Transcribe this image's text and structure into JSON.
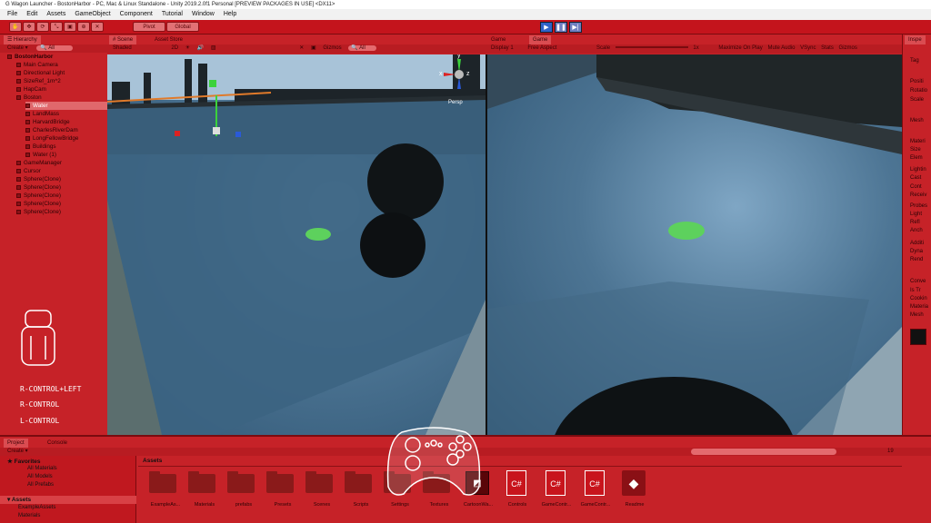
{
  "window": {
    "title": "G Wagon Launcher - BostonHarbor - PC, Mac & Linux Standalone - Unity 2019.2.0f1 Personal [PREVIEW PACKAGES IN USE] <DX11>"
  },
  "menu": [
    "File",
    "Edit",
    "Assets",
    "GameObject",
    "Component",
    "Tutorial",
    "Window",
    "Help"
  ],
  "toolbar": {
    "pivot": "Pivot",
    "global": "Global"
  },
  "hierarchy": {
    "tab": "Hierarchy",
    "create": "Create",
    "search": "All",
    "items": [
      "BostonHarbor",
      "Main Camera",
      "Directional Light",
      "SizeRef_1m^2",
      "HapCam",
      "Boston",
      "Water",
      "LandMass",
      "HarvardBridge",
      "CharlesRiverDam",
      "LongFellowBridge",
      "Buildings",
      "Water (1)",
      "GameManager",
      "Cursor",
      "Sphere(Clone)",
      "Sphere(Clone)",
      "Sphere(Clone)",
      "Sphere(Clone)",
      "Sphere(Clone)"
    ]
  },
  "scene": {
    "tab": "Scene",
    "tab2": "Asset Store",
    "shading": "Shaded",
    "mode2d": "2D",
    "gizmos": "Gizmos",
    "search": "All",
    "persp": "Persp",
    "axis_x": "x",
    "axis_y": "y",
    "axis_z": "z"
  },
  "game": {
    "tab": "Game",
    "tab_active": "Game",
    "display": "Display 1",
    "aspect": "Free Aspect",
    "scale_label": "Scale",
    "scale_value": "1x",
    "maximize": "Maximize On Play",
    "mute": "Mute Audio",
    "vsync": "VSync",
    "stats": "Stats",
    "gizmos": "Gizmos"
  },
  "inspector": {
    "tab": "Inspe",
    "items": [
      "Tag",
      "Positi",
      "Rotatio",
      "Scale",
      "Mesh",
      "Materi",
      "Size",
      "Elem",
      "Lightin",
      "Cast",
      "Cont",
      "Receiv",
      "Probes",
      "Light",
      "Refl",
      "Anch",
      "Additi",
      "Dyna",
      "Rend",
      "Conve",
      "Is Tr",
      "Cookin",
      "Materia",
      "Mesh"
    ]
  },
  "project": {
    "tab": "Project",
    "tab2": "Console",
    "create": "Create",
    "favorites": "Favorites",
    "fav_items": [
      "All Materials",
      "All Models",
      "All Prefabs"
    ],
    "assets_root": "Assets",
    "asset_tree": [
      "ExampleAssets",
      "Materials"
    ],
    "breadcrumb": "Assets",
    "count": "19",
    "assets": [
      {
        "label": "ExampleAs...",
        "kind": "folder"
      },
      {
        "label": "Materials",
        "kind": "folder"
      },
      {
        "label": "prefabs",
        "kind": "folder"
      },
      {
        "label": "Presets",
        "kind": "folder"
      },
      {
        "label": "Scenes",
        "kind": "folder"
      },
      {
        "label": "Scripts",
        "kind": "folder"
      },
      {
        "label": "Settings",
        "kind": "folder"
      },
      {
        "label": "Textures",
        "kind": "folder"
      },
      {
        "label": "CartoonWa...",
        "kind": "package"
      },
      {
        "label": "Controls",
        "kind": "cs"
      },
      {
        "label": "GameContr...",
        "kind": "cs"
      },
      {
        "label": "GameContr...",
        "kind": "cs"
      },
      {
        "label": "Readme",
        "kind": "unity"
      }
    ],
    "cs_glyph": "C#"
  },
  "overlay": {
    "controls": [
      "R-CONTROL+LEFT",
      "R-CONTROL",
      "L-CONTROL"
    ]
  }
}
